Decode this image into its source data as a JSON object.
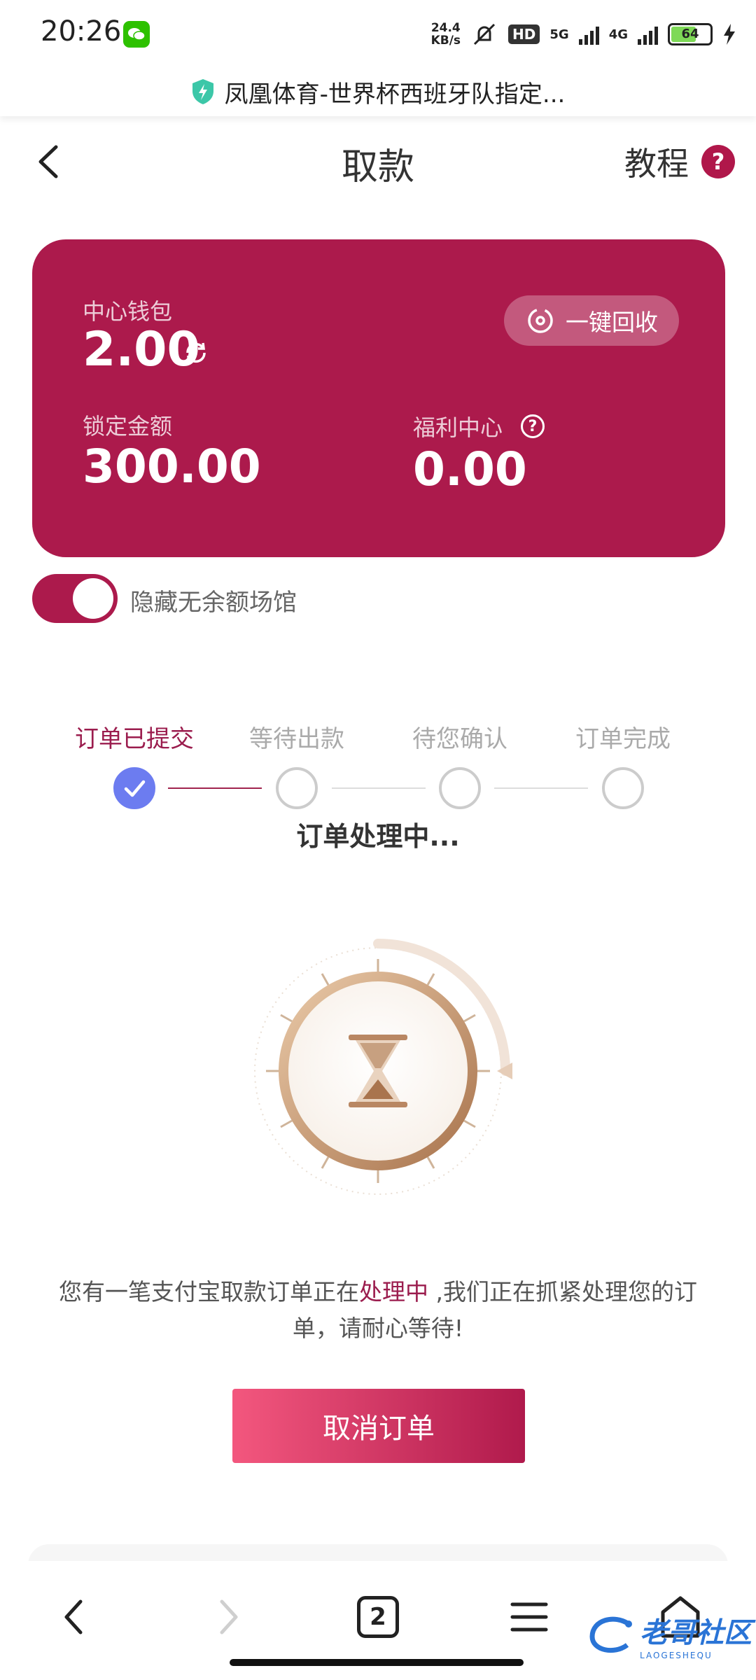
{
  "status_bar": {
    "time": "20:26",
    "net_speed_value": "24.4",
    "net_speed_unit": "KB/s",
    "hd_badge": "HD",
    "network_1": "5G",
    "network_2": "4G",
    "battery_level": "64"
  },
  "browser": {
    "page_title": "凤凰体育-世界杯西班牙队指定..."
  },
  "header": {
    "title": "取款",
    "tutorial_label": "教程",
    "help_symbol": "?"
  },
  "wallet": {
    "center_wallet_label": "中心钱包",
    "center_wallet_value": "2.00",
    "recycle_button": "一键回收",
    "locked_label": "锁定金额",
    "locked_value": "300.00",
    "welfare_label": "福利中心",
    "welfare_help": "?",
    "welfare_value": "0.00",
    "card_color": "#ac1a4c"
  },
  "toggle": {
    "label": "隐藏无余额场馆",
    "on": true
  },
  "steps": {
    "items": [
      {
        "label": "订单已提交",
        "done": true
      },
      {
        "label": "等待出款",
        "done": false
      },
      {
        "label": "待您确认",
        "done": false
      },
      {
        "label": "订单完成",
        "done": false
      }
    ],
    "status_text": "订单处理中..."
  },
  "message": {
    "part1": "您有一笔支付宝取款订单正在",
    "highlight": "处理中",
    "part2": " ,我们正在抓紧处理您的订单，请耐心等待!"
  },
  "cancel_button": "取消订单",
  "bottom_nav": {
    "tab_count": "2"
  },
  "watermark": {
    "text": "老哥社区",
    "subtext": "LAOGESHEQU"
  }
}
